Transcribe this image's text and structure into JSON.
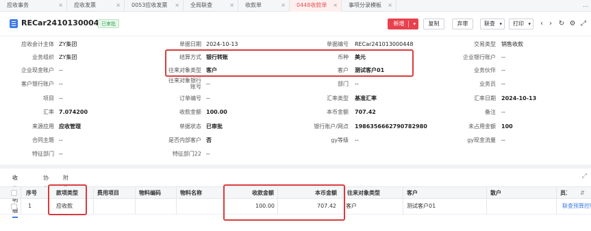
{
  "tabs": [
    {
      "label": "应收事务",
      "w": 98
    },
    {
      "label": "应收发票",
      "w": 84
    },
    {
      "label": "0053应收发票",
      "w": 86
    },
    {
      "label": "全局联查",
      "w": 80
    },
    {
      "label": "收款单",
      "w": 75
    },
    {
      "label": "0448收款单",
      "w": 76,
      "active": true
    },
    {
      "label": "事项分录模板",
      "w": 80
    }
  ],
  "tab_more": "…",
  "header": {
    "doc_no": "RECar241013000448",
    "status": "已审批",
    "buttons": {
      "new": "新增",
      "copy": "复制",
      "abandon": "弃审",
      "related": "联查",
      "print": "打印"
    }
  },
  "form": {
    "row1": {
      "l1": "应收会计主体",
      "v1": "ZY集团",
      "l2": "单据日期",
      "v2": "2024-10-13",
      "l3": "单据编号",
      "v3": "RECar241013000448",
      "l4": "交易类型",
      "v4": "销售收款"
    },
    "row2": {
      "l1": "业务组织",
      "v1": "ZY集团",
      "l2": "结算方式",
      "v2": "银行转账",
      "l3": "币种",
      "v3": "美元",
      "l4": "企业银行账户",
      "v4": "--"
    },
    "row3": {
      "l1": "企业现金账户",
      "v1": "--",
      "l2": "往来对象类型",
      "v2": "客户",
      "l3": "客户",
      "v3": "测试客户01",
      "l4": "业务伙伴",
      "v4": "--"
    },
    "row4": {
      "l1": "客户银行账户",
      "v1": "--",
      "l2a": "往来对象银行",
      "l2b": "账号",
      "v2": "--",
      "l3": "部门",
      "v3": "--",
      "l4": "业务员",
      "v4": "--"
    },
    "row5": {
      "l1": "项目",
      "v1": "--",
      "l2": "订单编号",
      "v2": "--",
      "l3": "汇率类型",
      "v3": "基准汇率",
      "l4": "汇率日期",
      "v4": "2024-10-13"
    },
    "row6": {
      "l1": "汇率",
      "v1": "7.074200",
      "l2": "收款金额",
      "v2": "100.00",
      "l3": "本币金额",
      "v3": "707.42",
      "l4": "备注",
      "v4": "--"
    },
    "row7": {
      "l1": "来源应用",
      "v1": "应收管理",
      "l2": "单据状态",
      "v2": "已审批",
      "l3": "银行账户/网点",
      "v3": "198635666279078298​0",
      "l4": "未占用金额",
      "v4": "100"
    },
    "row8": {
      "l1": "合同主题",
      "v1": "--",
      "l2": "是否内部客户",
      "v2": "否",
      "l3": "gy等级",
      "v3": "--",
      "l4": "gy现金流量",
      "v4": "--"
    },
    "row9": {
      "l1": "特征部门",
      "v1": "--",
      "l2": "特征部门22",
      "v2": "--"
    }
  },
  "detail": {
    "subtabs": [
      "收款明细",
      "协作",
      "附件"
    ],
    "columns": [
      "序号",
      "款项类型",
      "费用项目",
      "物料编码",
      "物料名称",
      "收款金额",
      "本币金额",
      "往来对象类型",
      "客户",
      "散户",
      "员工"
    ],
    "rows": [
      {
        "index": "1",
        "type": "应收款",
        "fee": "",
        "mat_code": "",
        "mat_name": "",
        "amount": "100.00",
        "local_amount": "707.42",
        "obj_type": "客户",
        "customer": "测试客户01",
        "retail": "",
        "staff": "",
        "action": "联查预算控制"
      }
    ]
  },
  "colors": {
    "accent": "#e8414d",
    "highlight_box": "#d93a3a",
    "approved": "#34a853",
    "link": "#3d7de6"
  }
}
